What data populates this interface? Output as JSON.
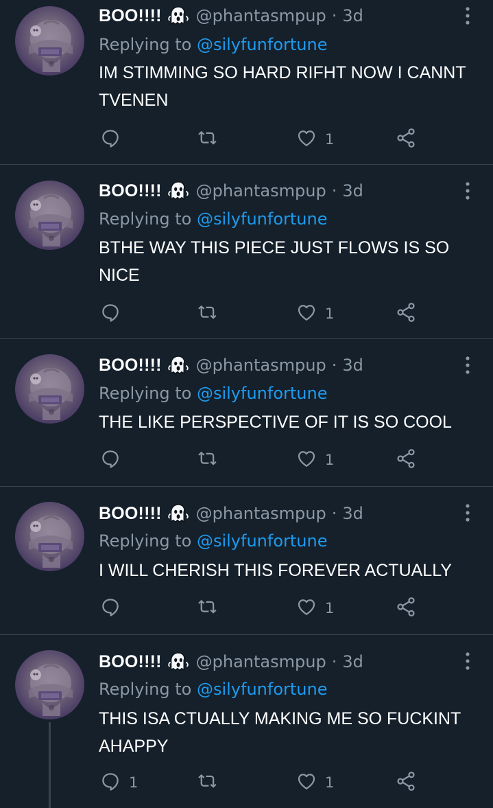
{
  "colors": {
    "background": "#15202b",
    "divider": "#38444d",
    "secondary_text": "#8b98a5",
    "link": "#1d9bf0",
    "primary_text": "#ffffff"
  },
  "tweets": [
    {
      "name": "BOO!!!!",
      "handle": "@phantasmpup",
      "separator": "·",
      "time": "3d",
      "reply_prefix": "Replying to",
      "reply_to": "@silyfunfortune",
      "text": "IM STIMMING SO HARD RIFHT NOW I CANNT TVENEN",
      "reply_count": "",
      "retweet_count": "",
      "like_count": "1"
    },
    {
      "name": "BOO!!!!",
      "handle": "@phantasmpup",
      "separator": "·",
      "time": "3d",
      "reply_prefix": "Replying to",
      "reply_to": "@silyfunfortune",
      "text": "BTHE WAY THIS PIECE JUST FLOWS IS SO NICE",
      "reply_count": "",
      "retweet_count": "",
      "like_count": "1"
    },
    {
      "name": "BOO!!!!",
      "handle": "@phantasmpup",
      "separator": "·",
      "time": "3d",
      "reply_prefix": "Replying to",
      "reply_to": "@silyfunfortune",
      "text": "THE LIKE PERSPECTIVE OF IT IS SO COOL",
      "reply_count": "",
      "retweet_count": "",
      "like_count": "1"
    },
    {
      "name": "BOO!!!!",
      "handle": "@phantasmpup",
      "separator": "·",
      "time": "3d",
      "reply_prefix": "Replying to",
      "reply_to": "@silyfunfortune",
      "text": "I WILL CHERISH THIS FOREVER ACTUALLY",
      "reply_count": "",
      "retweet_count": "",
      "like_count": "1"
    },
    {
      "name": "BOO!!!!",
      "handle": "@phantasmpup",
      "separator": "·",
      "time": "3d",
      "reply_prefix": "Replying to",
      "reply_to": "@silyfunfortune",
      "text": "THIS ISA CTUALLY MAKING ME SO FUCKINT AHAPPY",
      "reply_count": "1",
      "retweet_count": "",
      "like_count": "1"
    }
  ]
}
